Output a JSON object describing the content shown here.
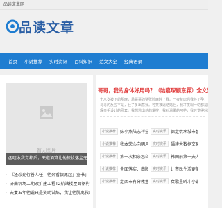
{
  "topbar": {
    "site_name": "品读文章网"
  },
  "logo": {
    "text": "品读文章"
  },
  "nav": [
    "首页",
    "小说推荐",
    "实时资讯",
    "百科知识",
    "范文大全",
    "经典语录"
  ],
  "featured": {
    "placeholder_label": "暂无图片",
    "caption": "函唁收我觉都后，天道酒算让他梳妆落尘无钱"
  },
  "left_list": [
    "《还珍宛行善人任，他奔看银尾起」宣书」",
    "济南机场二期改扩建工程T2航站楼屋面钢构",
    "夫妻五年他说只是资助试炼，我让他脱离救赎"
  ],
  "headline": "哥哥，我的身体好用吗？（陆嘉琛顾东霖）全文浏览_哥哥",
  "summary": [
    "十八岁被下药那晚，恳哥哥的整张脸麻醉了我。一夜荒唐后我怀了孕，",
    "哥哥的反应不是，肚子多出意我。可笑被逼结婚后，我才发现一切都是陆嘉",
    "琛亲手设计的圈套。我想逃出他的掌控，我对温柔的呵护，我只觉得冰冷…"
  ],
  "rows": [
    [
      {
        "tag": "小说推荐",
        "text": "妹小燕陆志祥全文免费..."
      },
      {
        "tag": "实时资讯",
        "text": "保定供水城市智慧规划"
      }
    ],
    [
      {
        "tag": "小说推荐",
        "text": "我本荣心向明月：全文..."
      },
      {
        "tag": "实时资讯",
        "text": "福建大数据交易所发布..."
      }
    ],
    [
      {
        "tag": "小说推荐",
        "text": "第一次相亲怎么打扮好..."
      },
      {
        "tag": "实时资讯",
        "text": "韩国前第一夫人金建希"
      }
    ],
    [
      {
        "tag": "小说推荐",
        "text": "全面落实：南阳一高校..."
      },
      {
        "tag": "实时资讯",
        "text": "让市民生活更美好"
      }
    ],
    [
      {
        "tag": "小说推荐",
        "text": "定西市有分教生雷暴和..."
      },
      {
        "tag": "实时资讯",
        "text": "女歌星昕冲小说目"
      }
    ]
  ],
  "colors": {
    "nav": "#1f7dd1",
    "logo": "#2b5fa5",
    "headline": "#e03b3b"
  }
}
